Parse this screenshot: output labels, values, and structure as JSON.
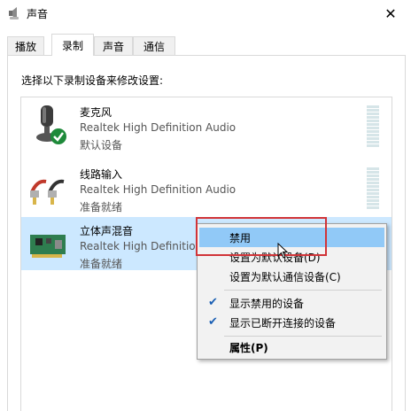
{
  "window": {
    "title": "声音",
    "close_glyph": "✕"
  },
  "tabs": [
    {
      "label": "播放",
      "active": false
    },
    {
      "label": "录制",
      "active": true
    },
    {
      "label": "声音",
      "active": false
    },
    {
      "label": "通信",
      "active": false
    }
  ],
  "instruction": "选择以下录制设备来修改设置:",
  "devices": [
    {
      "name": "麦克风",
      "description": "Realtek High Definition Audio",
      "status": "默认设备",
      "icon": "microphone-icon",
      "default": true
    },
    {
      "name": "线路输入",
      "description": "Realtek High Definition Audio",
      "status": "准备就绪",
      "icon": "line-in-cable-icon"
    },
    {
      "name": "立体声混音",
      "description": "Realtek High Definition Audio",
      "status": "准备就绪",
      "icon": "sound-card-icon",
      "selected": true
    }
  ],
  "context_menu": {
    "items": [
      {
        "label": "禁用",
        "hover": true
      },
      {
        "label": "设置为默认设备(D)"
      },
      {
        "label": "设置为默认通信设备(C)"
      },
      {
        "label": "显示禁用的设备",
        "checked": true
      },
      {
        "label": "显示已断开连接的设备",
        "checked": true
      },
      {
        "label": "属性(P)",
        "bold": true
      }
    ],
    "check_glyph": "✔"
  },
  "colors": {
    "selection": "#cce8ff",
    "menu_hover": "#91c9f7",
    "highlight_box": "#d13438",
    "check": "#1a5fb4"
  }
}
